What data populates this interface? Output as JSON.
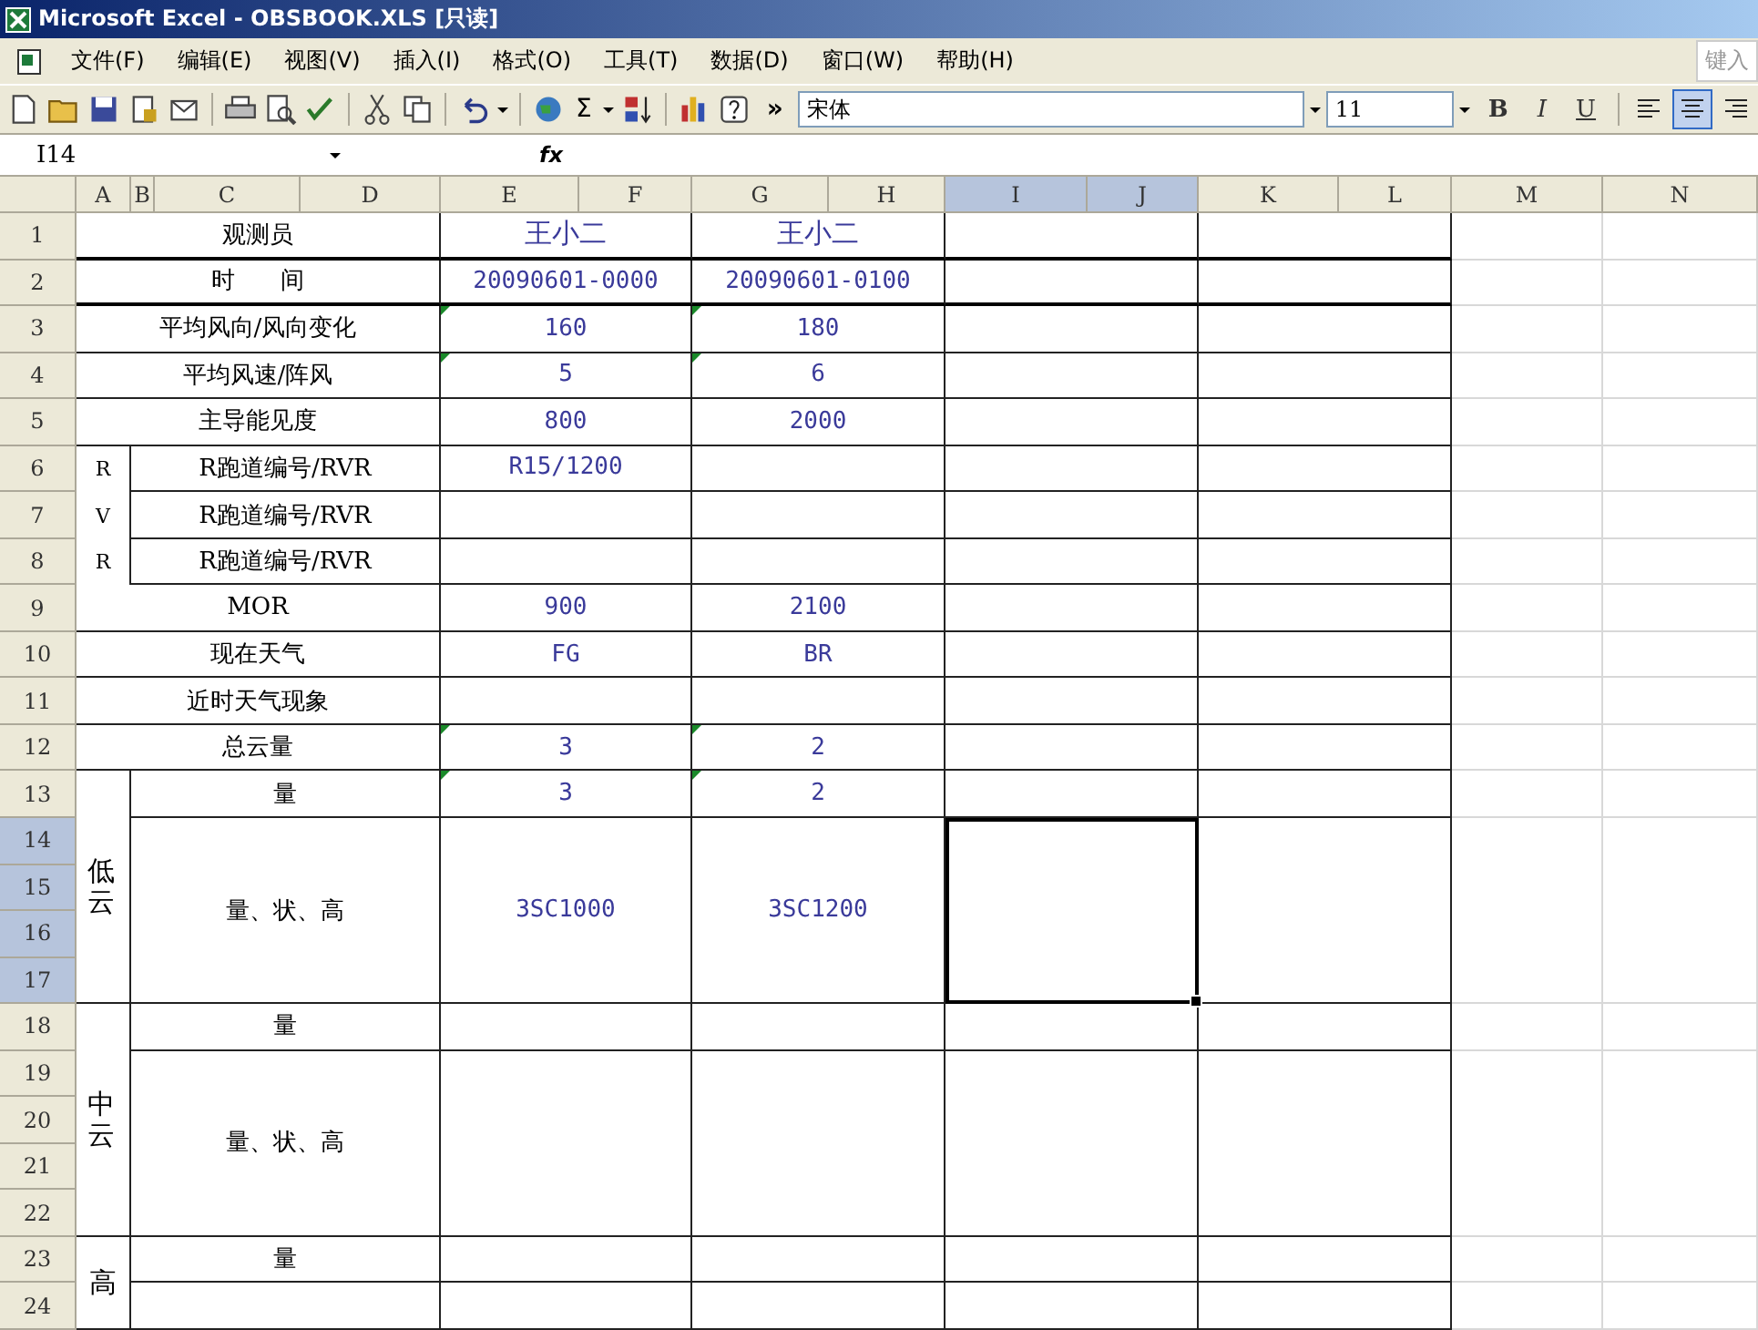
{
  "window": {
    "title": "Microsoft Excel - OBSBOOK.XLS [只读]"
  },
  "menu": [
    "文件(F)",
    "编辑(E)",
    "视图(V)",
    "插入(I)",
    "格式(O)",
    "工具(T)",
    "数据(D)",
    "窗口(W)",
    "帮助(H)"
  ],
  "help_box": {
    "placeholder": "键入"
  },
  "toolbar": {
    "sum_symbol": "Σ",
    "more": "»",
    "font": "宋体",
    "font_size": "11",
    "bold": "B",
    "italic": "I",
    "underline": "U",
    "align": [
      {
        "selected": false
      },
      {
        "selected": true
      },
      {
        "selected": false
      }
    ]
  },
  "formula_bar": {
    "name_box": "I14",
    "fx": "fx"
  },
  "sheet": {
    "columns": [
      {
        "letter": "A",
        "selected": false
      },
      {
        "letter": "B",
        "selected": false
      },
      {
        "letter": "C",
        "selected": false
      },
      {
        "letter": "D",
        "selected": false
      },
      {
        "letter": "E",
        "selected": false
      },
      {
        "letter": "F",
        "selected": false
      },
      {
        "letter": "G",
        "selected": false
      },
      {
        "letter": "H",
        "selected": false
      },
      {
        "letter": "I",
        "selected": true
      },
      {
        "letter": "J",
        "selected": true
      },
      {
        "letter": "K",
        "selected": false
      },
      {
        "letter": "L",
        "selected": false
      },
      {
        "letter": "M",
        "selected": false
      },
      {
        "letter": "N",
        "selected": false
      }
    ],
    "rows": [
      {
        "number": "1",
        "selected": false
      },
      {
        "number": "2",
        "selected": false
      },
      {
        "number": "3",
        "selected": false
      },
      {
        "number": "4",
        "selected": false
      },
      {
        "number": "5",
        "selected": false
      },
      {
        "number": "6",
        "selected": false
      },
      {
        "number": "7",
        "selected": false
      },
      {
        "number": "8",
        "selected": false
      },
      {
        "number": "9",
        "selected": false
      },
      {
        "number": "10",
        "selected": false
      },
      {
        "number": "11",
        "selected": false
      },
      {
        "number": "12",
        "selected": false
      },
      {
        "number": "13",
        "selected": false
      },
      {
        "number": "14",
        "selected": true
      },
      {
        "number": "15",
        "selected": true
      },
      {
        "number": "16",
        "selected": true
      },
      {
        "number": "17",
        "selected": true
      },
      {
        "number": "18",
        "selected": false
      },
      {
        "number": "19",
        "selected": false
      },
      {
        "number": "20",
        "selected": false
      },
      {
        "number": "21",
        "selected": false
      },
      {
        "number": "22",
        "selected": false
      },
      {
        "number": "23",
        "selected": false
      },
      {
        "number": "24",
        "selected": false
      }
    ]
  },
  "table": {
    "rows": [
      {
        "label": "观测员",
        "values": [
          "王小二",
          "王小二"
        ],
        "heavy_border": true,
        "flagged": false
      },
      {
        "label": "时      间",
        "values": [
          "20090601-0000",
          "20090601-0100"
        ],
        "heavy_border": true,
        "flagged": false
      },
      {
        "label": "平均风向/风向变化",
        "values": [
          "160",
          "180"
        ],
        "heavy_border": false,
        "flagged": true
      },
      {
        "label": "平均风速/阵风",
        "values": [
          "5",
          "6"
        ],
        "heavy_border": false,
        "flagged": true
      },
      {
        "label": "主导能见度",
        "values": [
          "800",
          "2000"
        ],
        "heavy_border": false,
        "flagged": false
      },
      {
        "side_letter": "R",
        "label": "R跑道编号/RVR",
        "values": [
          "R15/1200"
        ],
        "heavy_border": false,
        "flagged": false
      },
      {
        "side_letter": "V",
        "label": "R跑道编号/RVR",
        "heavy_border": false,
        "flagged": false
      },
      {
        "side_letter": "R",
        "label": "R跑道编号/RVR",
        "heavy_border": false,
        "flagged": false
      },
      {
        "label": "MOR",
        "values": [
          "900",
          "2100"
        ],
        "heavy_border": false,
        "flagged": false
      },
      {
        "label": "现在天气",
        "values": [
          "FG",
          "BR"
        ],
        "heavy_border": false,
        "flagged": false
      },
      {
        "label": "近时天气现象",
        "heavy_border": false,
        "flagged": false
      },
      {
        "label": "总云量",
        "values": [
          "3",
          "2"
        ],
        "heavy_border": false,
        "flagged": true
      }
    ],
    "groups": [
      {
        "label": "低云",
        "amount_label": "量",
        "amount_values": [
          "3",
          "2"
        ],
        "flagged": true,
        "detail_label": "量、状、高",
        "detail_values": [
          "3SC1000",
          "3SC1200"
        ]
      },
      {
        "label": "中云",
        "amount_label": "量",
        "flagged": false,
        "detail_label": "量、状、高"
      },
      {
        "label": "高",
        "amount_label": "量",
        "flagged": false
      }
    ]
  }
}
